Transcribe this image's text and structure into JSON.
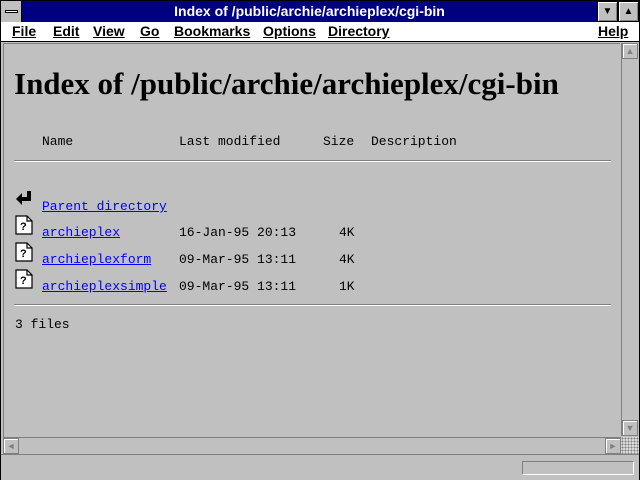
{
  "window": {
    "title": "Index of /public/archie/archieplex/cgi-bin",
    "minimize_glyph": "▼",
    "maximize_glyph": "▲"
  },
  "menu": {
    "file": "File",
    "edit": "Edit",
    "view": "View",
    "go": "Go",
    "bookmarks": "Bookmarks",
    "options": "Options",
    "directory": "Directory",
    "help": "Help"
  },
  "page": {
    "heading": "Index of /public/archie/archieplex/cgi-bin",
    "columns": {
      "name": "Name",
      "last_modified": "Last modified",
      "size": "Size",
      "description": "Description"
    },
    "parent": {
      "label": "Parent directory",
      "icon": "back-arrow-icon"
    },
    "files": [
      {
        "name": "archieplex",
        "modified": "16-Jan-95 20:13",
        "size": "4K",
        "icon": "unknown-file-icon"
      },
      {
        "name": "archieplexform",
        "modified": "09-Mar-95 13:11",
        "size": "4K",
        "icon": "unknown-file-icon"
      },
      {
        "name": "archieplexsimple",
        "modified": "09-Mar-95 13:11",
        "size": "1K",
        "icon": "unknown-file-icon"
      }
    ],
    "footer": "3 files"
  },
  "scrollbars": {
    "up": "▲",
    "down": "▼",
    "left": "◄",
    "right": "►"
  }
}
